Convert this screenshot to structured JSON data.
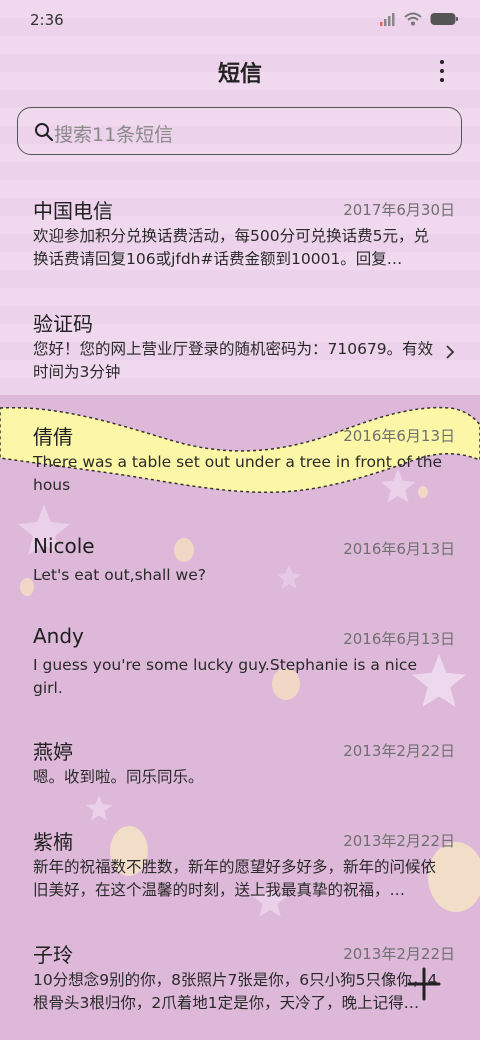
{
  "status": {
    "time": "2:36"
  },
  "header": {
    "title": "短信"
  },
  "search": {
    "placeholder": "搜索11条短信"
  },
  "messages": [
    {
      "sender": "中国电信",
      "date": "2017年6月30日",
      "preview": "欢迎参加积分兑换话费活动，每500分可兑换话费5元，兑换话费请回复106或jfdh#话费金额到10001。回复…"
    },
    {
      "sender": "验证码",
      "date": "",
      "preview": "您好！您的网上营业厅登录的随机密码为：710679。有效时间为3分钟"
    },
    {
      "sender": "倩倩",
      "date": "2016年6月13日",
      "preview": "There was a table set out under a tree in front of the hous"
    },
    {
      "sender": "Nicole",
      "date": "2016年6月13日",
      "preview": "Let's eat out,shall we?"
    },
    {
      "sender": "Andy",
      "date": "2016年6月13日",
      "preview": "I guess you're some lucky guy.Stephanie is a nice girl."
    },
    {
      "sender": "燕婷",
      "date": "2013年2月22日",
      "preview": "嗯。收到啦。同乐同乐。"
    },
    {
      "sender": "紫楠",
      "date": "2013年2月22日",
      "preview": "新年的祝福数不胜数，新年的愿望好多好多，新年的问候依旧美好，在这个温馨的时刻，送上我最真挚的祝福，…"
    },
    {
      "sender": "子玲",
      "date": "2013年2月22日",
      "preview": "10分想念9别的你，8张照片7张是你，6只小狗5只像你，4根骨头3根归你，2爪着地1定是你，天冷了，晚上记得…"
    }
  ],
  "icons": {
    "search": "search-icon",
    "more": "more-vertical-icon",
    "chevron": "chevron-right-icon",
    "compose": "plus-icon"
  },
  "colors": {
    "wave": "#fbf7a6",
    "lower_background": "#ddb8d9",
    "upper_background": "#f0d9ee"
  }
}
